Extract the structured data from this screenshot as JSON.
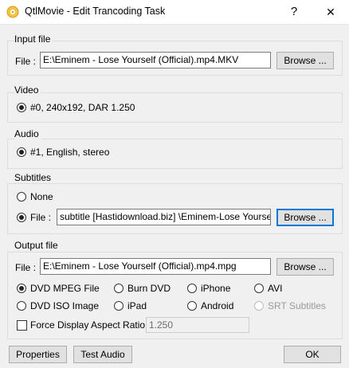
{
  "window": {
    "title": "QtlMovie - Edit Trancoding Task",
    "help_glyph": "?",
    "close_glyph": "✕",
    "icon": "qtlmovie-app-icon"
  },
  "input_file": {
    "group_label": "Input file",
    "file_label": "File :",
    "file_value": "E:\\Eminem - Lose Yourself (Official).mp4.MKV",
    "browse_label": "Browse ..."
  },
  "video": {
    "group_label": "Video",
    "stream": "#0, 240x192, DAR 1.250"
  },
  "audio": {
    "group_label": "Audio",
    "stream": "#1, English, stereo"
  },
  "subtitles": {
    "group_label": "Subtitles",
    "none_label": "None",
    "file_label": "File :",
    "file_value": "subtitle [Hastidownload.biz] \\Eminem-Lose Yourself.srt",
    "browse_label": "Browse ...",
    "selected": "file"
  },
  "output_file": {
    "group_label": "Output file",
    "file_label": "File :",
    "file_value": "E:\\Eminem - Lose Yourself (Official).mp4.mpg",
    "browse_label": "Browse ...",
    "formats": {
      "dvd_mpeg": "DVD MPEG File",
      "burn_dvd": "Burn DVD",
      "iphone": "iPhone",
      "avi": "AVI",
      "dvd_iso": "DVD ISO Image",
      "ipad": "iPad",
      "android": "Android",
      "srt": "SRT Subtitles"
    },
    "selected_format": "DVD MPEG File",
    "force_dar_label": "Force Display Aspect Ratio :",
    "force_dar_checked": false,
    "dar_value": "1.250"
  },
  "footer": {
    "properties_label": "Properties",
    "test_audio_label": "Test Audio",
    "ok_label": "OK"
  },
  "colors": {
    "focus": "#0078d7",
    "dialog_bg": "#f0f0f0",
    "group_border": "#dcdcdc"
  }
}
